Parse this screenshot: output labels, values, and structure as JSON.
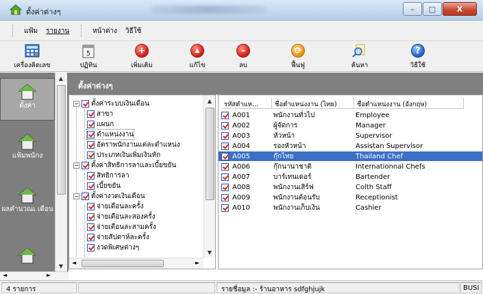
{
  "window": {
    "title": "ตั้งค่าต่างๆ",
    "minimize": "–",
    "maximize": "□",
    "close": "X"
  },
  "menu": {
    "group1": [
      "แฟ้ม",
      "รายงาน"
    ],
    "group2": [
      "หน้าต่าง",
      "วิธีใช้"
    ]
  },
  "toolbar": [
    {
      "label": "เครื่องคิดเลข",
      "icon": "calculator-icon"
    },
    {
      "label": "ปฏิทิน",
      "icon": "calendar-icon",
      "glyph": "5"
    },
    {
      "label": "เพิ่มเติม",
      "icon": "add-icon",
      "glyph": "+"
    },
    {
      "label": "แก้ไข",
      "icon": "edit-icon",
      "glyph": "▲"
    },
    {
      "label": "ลบ",
      "icon": "delete-icon",
      "glyph": "–"
    },
    {
      "label": "ฟื้นฟู",
      "icon": "refresh-icon",
      "glyph": "⟳"
    },
    {
      "label": "ค้นหา",
      "icon": "search-icon"
    },
    {
      "label": "วิธีใช้",
      "icon": "help-icon",
      "glyph": "?"
    }
  ],
  "nav": [
    {
      "label": "ตั้งค่า",
      "selected": true
    },
    {
      "label": "แฟ้มพนักง"
    },
    {
      "label": "ผลคำนวณเ เดือน"
    }
  ],
  "panel": {
    "title": "ตั้งค่าต่างๆ"
  },
  "tree": [
    {
      "label": "ตั้งค่าระบบเงินเดือน",
      "level": 0
    },
    {
      "label": "สาขา",
      "level": 1
    },
    {
      "label": "แผนก",
      "level": 1
    },
    {
      "label": "ตำแหน่งงาน",
      "level": 1
    },
    {
      "label": "อัตราพนักงานแต่ละตำแหน่ง",
      "level": 1
    },
    {
      "label": "ประเภทเงินเพิ่มเงินหัก",
      "level": 1
    },
    {
      "label": "ตั้งค่าสิทธิการลาและเบี้ยขยัน",
      "level": 0
    },
    {
      "label": "สิทธิการลา",
      "level": 1
    },
    {
      "label": "เบี้ยขยัน",
      "level": 1
    },
    {
      "label": "ตั้งค่างวดเงินเดือน",
      "level": 0
    },
    {
      "label": "จ่ายเดือนละครั้ง",
      "level": 1
    },
    {
      "label": "จ่ายเดือนละสองครั้ง",
      "level": 1
    },
    {
      "label": "จ่ายเดือนละสามครั้ง",
      "level": 1
    },
    {
      "label": "จ่ายสัปดาห์ละครั้ง",
      "level": 1
    },
    {
      "label": "งวดพิเศษต่างๆ",
      "level": 1
    }
  ],
  "grid": {
    "columns": [
      "รหัสตำแห...",
      "ชื่อตำแหน่งงาน (ไทย)",
      "ชื่อตำแหน่งงาน (อังกฤษ)"
    ],
    "rows": [
      [
        "A001",
        "พนักงานทั่วไป",
        "Employee"
      ],
      [
        "A002",
        "ผู้จัดการ",
        "Manager"
      ],
      [
        "A003",
        "หัวหน้า",
        "Supervisor"
      ],
      [
        "A004",
        "รองหัวหน้า",
        "Assistan Supervisor"
      ],
      [
        "A005",
        "กุ๊กไทย",
        "Thailand Chef"
      ],
      [
        "A006",
        "กุ๊กนานาชาติ",
        "Internationnal Chefs"
      ],
      [
        "A007",
        "บาร์เทนเดอร์",
        "Bartender"
      ],
      [
        "A008",
        "พนักงานเสิร์ฟ",
        "Colth Staff"
      ],
      [
        "A009",
        "พนักงานต้อนรับ",
        "Receptionist"
      ],
      [
        "A010",
        "พนักงานเก็บเงิน",
        "Cashier"
      ]
    ],
    "selected_index": 4
  },
  "status": {
    "count": "4 รายการ",
    "info": "รายชื่อมูล :- ร้านอาหาร sdfghjujk",
    "busy": "BUSI"
  },
  "colors": {
    "selection": "#3d6fc8",
    "nav_bg": "#7e7e7e",
    "header_bg": "#808080"
  }
}
